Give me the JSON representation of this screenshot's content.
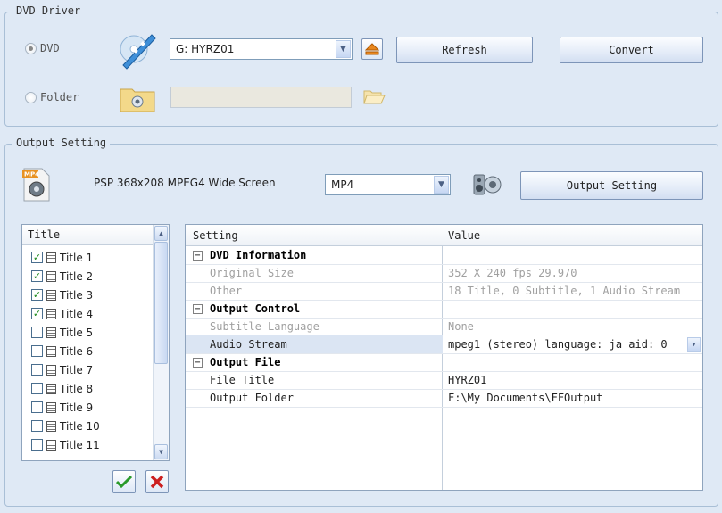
{
  "dvd_group": {
    "legend": "DVD Driver",
    "dvd_radio_label": "DVD",
    "folder_radio_label": "Folder",
    "drive_selected": "G: HYRZ01",
    "folder_path": "",
    "refresh_label": "Refresh",
    "convert_label": "Convert"
  },
  "output_group": {
    "legend": "Output Setting",
    "profile_name": "PSP 368x208 MPEG4 Wide Screen",
    "format_selected": "MP4",
    "output_setting_label": "Output Setting",
    "mp4_badge": "MP4"
  },
  "title_list": {
    "header": "Title",
    "items": [
      {
        "label": "Title 1",
        "checked": true
      },
      {
        "label": "Title 2",
        "checked": true
      },
      {
        "label": "Title 3",
        "checked": true
      },
      {
        "label": "Title 4",
        "checked": true
      },
      {
        "label": "Title 5",
        "checked": false
      },
      {
        "label": "Title 6",
        "checked": false
      },
      {
        "label": "Title 7",
        "checked": false
      },
      {
        "label": "Title 8",
        "checked": false
      },
      {
        "label": "Title 9",
        "checked": false
      },
      {
        "label": "Title 10",
        "checked": false
      },
      {
        "label": "Title 11",
        "checked": false
      }
    ]
  },
  "settings_grid": {
    "col_setting": "Setting",
    "col_value": "Value",
    "sections": {
      "dvd_info": "DVD Information",
      "output_control": "Output Control",
      "output_file": "Output File"
    },
    "rows": {
      "original_size": {
        "name": "Original Size",
        "value": "352 X 240 fps 29.970"
      },
      "other": {
        "name": "Other",
        "value": "18 Title, 0 Subtitle, 1 Audio Stream"
      },
      "subtitle_language": {
        "name": "Subtitle Language",
        "value": "None"
      },
      "audio_stream": {
        "name": "Audio Stream",
        "value": "mpeg1 (stereo) language: ja aid: 0"
      },
      "file_title": {
        "name": "File Title",
        "value": "HYRZ01"
      },
      "output_folder": {
        "name": "Output Folder",
        "value": "F:\\My Documents\\FFOutput"
      }
    }
  },
  "icons": {
    "dvd": "dvd-film-icon",
    "eject": "eject-icon",
    "folder_cam": "folder-camera-icon",
    "browse": "open-folder-icon",
    "mp4": "mp4-file-icon",
    "speaker": "speaker-settings-icon",
    "check_all": "green-check-icon",
    "uncheck_all": "red-x-icon"
  },
  "colors": {
    "background": "#dfe9f5",
    "selection": "#dbe5f3",
    "check_green": "#2a9a2a",
    "x_red": "#cc1f1f"
  }
}
